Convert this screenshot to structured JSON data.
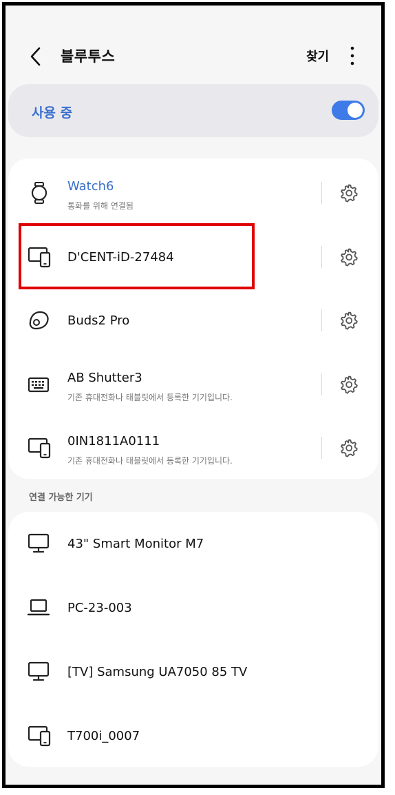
{
  "header": {
    "title": "블루투스",
    "search_label": "찾기"
  },
  "master": {
    "label": "사용 중",
    "enabled": true,
    "accent_color": "#3e7be8"
  },
  "paired": [
    {
      "name": "Watch6",
      "status": "통화를 위해 연결됨",
      "icon": "watch-icon",
      "connected": true
    },
    {
      "name": "D'CENT-iD-27484",
      "status": "",
      "icon": "tablet-phone-icon",
      "connected": false
    },
    {
      "name": "Buds2 Pro",
      "status": "",
      "icon": "earbuds-icon",
      "connected": false
    },
    {
      "name": "AB Shutter3",
      "status": "기존 휴대전화나 태블릿에서 등록한 기기입니다.",
      "icon": "keyboard-icon",
      "connected": false
    },
    {
      "name": "0IN1811A0111",
      "status": "기존 휴대전화나 태블릿에서 등록한 기기입니다.",
      "icon": "tablet-phone-icon",
      "connected": false
    }
  ],
  "available_section_label": "연결 가능한 기기",
  "available": [
    {
      "name": "43\" Smart Monitor M7",
      "icon": "monitor-icon"
    },
    {
      "name": "PC-23-003",
      "icon": "laptop-icon"
    },
    {
      "name": "[TV] Samsung UA7050 85 TV",
      "icon": "monitor-icon"
    },
    {
      "name": "T700i_0007",
      "icon": "tablet-phone-icon"
    }
  ],
  "highlight_color": "#e00000"
}
